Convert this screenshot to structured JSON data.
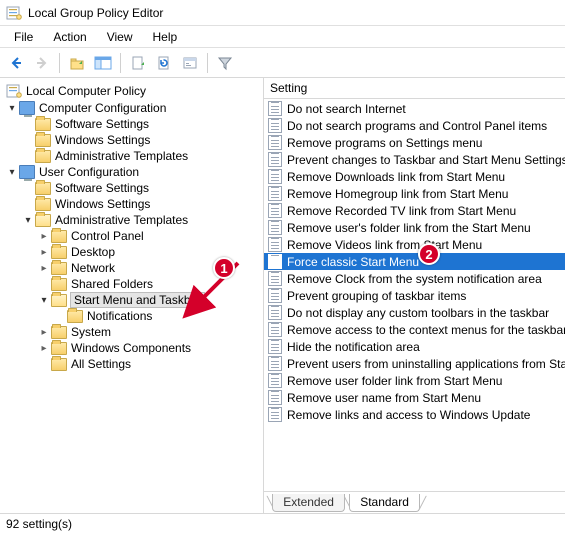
{
  "window": {
    "title": "Local Group Policy Editor"
  },
  "menubar": [
    "File",
    "Action",
    "View",
    "Help"
  ],
  "tree": {
    "root": "Local Computer Policy",
    "nodes": [
      {
        "label": "Computer Configuration",
        "expanded": true,
        "children": [
          {
            "label": "Software Settings"
          },
          {
            "label": "Windows Settings"
          },
          {
            "label": "Administrative Templates"
          }
        ]
      },
      {
        "label": "User Configuration",
        "expanded": true,
        "children": [
          {
            "label": "Software Settings"
          },
          {
            "label": "Windows Settings"
          },
          {
            "label": "Administrative Templates",
            "expanded": true,
            "children": [
              {
                "label": "Control Panel",
                "hasChildren": true
              },
              {
                "label": "Desktop",
                "hasChildren": true
              },
              {
                "label": "Network",
                "hasChildren": true
              },
              {
                "label": "Shared Folders"
              },
              {
                "label": "Start Menu and Taskbar",
                "expanded": true,
                "selected": true,
                "children": [
                  {
                    "label": "Notifications"
                  }
                ]
              },
              {
                "label": "System",
                "hasChildren": true
              },
              {
                "label": "Windows Components",
                "hasChildren": true
              },
              {
                "label": "All Settings"
              }
            ]
          }
        ]
      }
    ]
  },
  "list": {
    "header": "Setting",
    "selected_index": 9,
    "items": [
      "Do not search Internet",
      "Do not search programs and Control Panel items",
      "Remove programs on Settings menu",
      "Prevent changes to Taskbar and Start Menu Settings",
      "Remove Downloads link from Start Menu",
      "Remove Homegroup link from Start Menu",
      "Remove Recorded TV link from Start Menu",
      "Remove user's folder link from the Start Menu",
      "Remove Videos link from Start Menu",
      "Force classic Start Menu",
      "Remove Clock from the system notification area",
      "Prevent grouping of taskbar items",
      "Do not display any custom toolbars in the taskbar",
      "Remove access to the context menus for the taskbar",
      "Hide the notification area",
      "Prevent users from uninstalling applications from Start",
      "Remove user folder link from Start Menu",
      "Remove user name from Start Menu",
      "Remove links and access to Windows Update"
    ]
  },
  "tabs": {
    "extended": "Extended",
    "standard": "Standard"
  },
  "status": "92 setting(s)",
  "annotations": {
    "badge1": "1",
    "badge2": "2"
  }
}
